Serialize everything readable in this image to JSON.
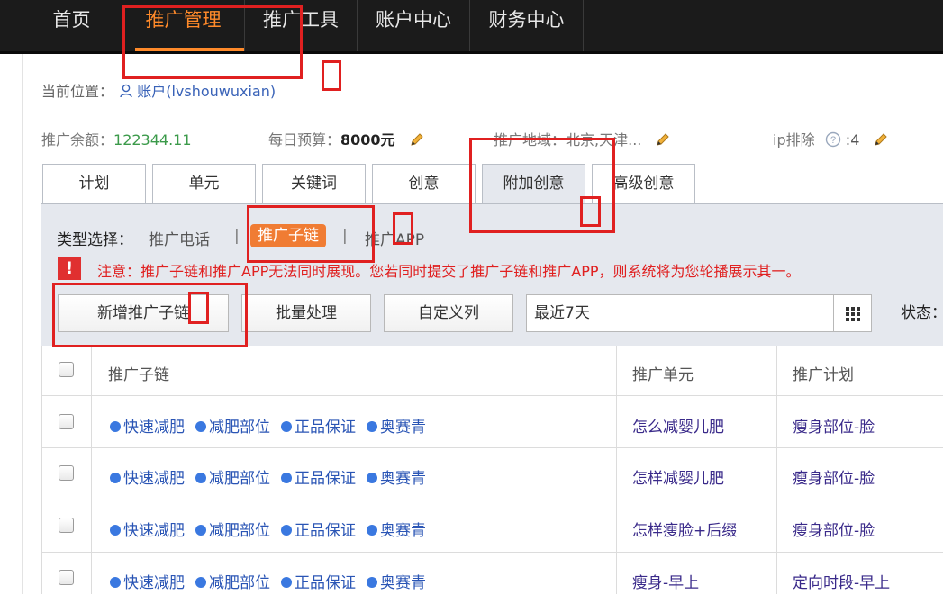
{
  "topnav": {
    "items": [
      {
        "label": "首页"
      },
      {
        "label": "推广管理"
      },
      {
        "label": "推广工具"
      },
      {
        "label": "账户中心"
      },
      {
        "label": "财务中心"
      }
    ]
  },
  "breadcrumb": {
    "prefix": "当前位置：",
    "account_label": "账户",
    "account_name": "(lvshouwuxian)"
  },
  "stats": {
    "balance_label": "推广余额：",
    "balance_value": "122344.11",
    "budget_label": "每日预算：",
    "budget_value": "8000元",
    "region_label": "推广地域：",
    "region_value": "北京,天津...",
    "ip_label": "ip排除",
    "ip_value": ":4"
  },
  "tabs": [
    {
      "label": "计划"
    },
    {
      "label": "单元"
    },
    {
      "label": "关键词"
    },
    {
      "label": "创意"
    },
    {
      "label": "附加创意"
    },
    {
      "label": "高级创意"
    }
  ],
  "type_select": {
    "label": "类型选择：",
    "options": [
      {
        "label": "推广电话"
      },
      {
        "label": "推广子链"
      },
      {
        "label": "推广APP"
      }
    ],
    "separator": "|"
  },
  "warning": {
    "text": "注意：推广子链和推广APP无法同时展现。您若同时提交了推广子链和推广APP，则系统将为您轮播展示其一。"
  },
  "toolbar": {
    "add_label": "新增推广子链",
    "batch_label": "批量处理",
    "custom_cols_label": "自定义列",
    "date_value": "最近7天",
    "status_label": "状态："
  },
  "table": {
    "headers": [
      "推广子链",
      "推广单元",
      "推广计划"
    ],
    "rows": [
      {
        "links": [
          "快速减肥",
          "减肥部位",
          "正品保证",
          "奥赛青"
        ],
        "unit": "怎么减婴儿肥",
        "plan": "瘦身部位-脸"
      },
      {
        "links": [
          "快速减肥",
          "减肥部位",
          "正品保证",
          "奥赛青"
        ],
        "unit": "怎样减婴儿肥",
        "plan": "瘦身部位-脸"
      },
      {
        "links": [
          "快速减肥",
          "减肥部位",
          "正品保证",
          "奥赛青"
        ],
        "unit": "怎样瘦脸+后缀",
        "plan": "瘦身部位-脸"
      },
      {
        "links": [
          "快速减肥",
          "减肥部位",
          "正品保证",
          "奥赛青"
        ],
        "unit": "瘦身-早上",
        "plan": "定向时段-早上"
      }
    ]
  },
  "colors": {
    "accent": "#ff8a2a",
    "nav_bg": "#1b1b1b",
    "warning": "#e02020",
    "link": "#2a55b5"
  }
}
